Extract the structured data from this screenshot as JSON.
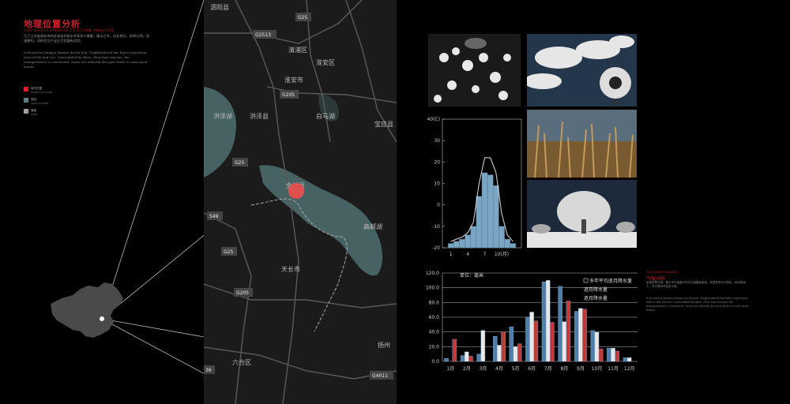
{
  "left_panel": {
    "title": "地理位置分析",
    "subtitle": "THE GEOGRAPHICAL POSITION ANALYSIS",
    "body_cn": "位于江苏省淮安市的金湖县北依水乡获有千美誉，集水之乡，历史悠久，四季分明，交通便利，同样也可产业生活发展有优势。",
    "body_en": "Is located in Jiangsu Huaian Jin Hu-Jian, Neighborhood has had a reputation, land of fish and rice. Surrounded by lakes, clear four seasons, the transportation is convenient. Same our industry also give birth to some good homes.",
    "legend": [
      {
        "label": "城市位置",
        "sub": "PROJECT LOCATION",
        "color": "#e21b2a"
      },
      {
        "label": "湖泊",
        "sub": "LAKE LOCATION",
        "color": "#5c7f80"
      },
      {
        "label": "道路",
        "sub": "ROAD",
        "color": "#a89da0"
      }
    ]
  },
  "map_labels": {
    "sihong": "泗阳县",
    "g25_top": "G25",
    "g2513": "G2513",
    "huaian": "淮安市",
    "qinghe": "清浦区",
    "huaiyin": "淮安区",
    "g205_a": "G205",
    "hongze_lake": "洪泽湖",
    "hongze": "洪泽县",
    "baima": "白马湖",
    "baoying": "宝应县",
    "g25_mid": "G25",
    "jinhu": "金湖县",
    "s49": "S49",
    "gaoyou_lake": "高邮湖",
    "g25_low": "G25",
    "tianchang": "天长市",
    "g205_b": "G205",
    "yangzhou": "扬州",
    "luhe": "六合区",
    "g4011": "G4011",
    "s36": "36"
  },
  "right_annotation": {
    "title_en": "THE CLIMATE ANALYSIS",
    "title": "气候分析",
    "body_cn": "金湖四季分明，春天冷均温度开在升在温暖适宜度，明显夏季长日照足，秋凉爽宜人，冬冷寒有时较多中雨。",
    "body_en": "Is located in Jiangsu Huaian Jin Hu-Jian, Neighborhood has had a reputation, land of fish and rice. Surrounded by lakes, clear four seasons, the transportation is convenient. Same our industry also give birth to some good homes."
  },
  "chart_data": [
    {
      "type": "bar",
      "title": "",
      "ylabel_top": "40(C)",
      "y_ticks": [
        40,
        30,
        20,
        10,
        0,
        -10,
        -20
      ],
      "x_ticks": [
        "1",
        "4",
        "7",
        "10(月)"
      ],
      "ylim": [
        -20,
        40
      ],
      "categories": [
        "1",
        "2",
        "3",
        "4",
        "5",
        "6",
        "7",
        "8",
        "9",
        "10",
        "11",
        "12"
      ],
      "bars_values": [
        -18,
        -17,
        -16,
        -14,
        -10,
        4,
        15,
        14,
        9,
        -10,
        -16,
        -18
      ],
      "curve_values": [
        -17,
        -16,
        -15,
        -13,
        -8,
        10,
        22,
        22,
        15,
        -4,
        -14,
        -17
      ]
    },
    {
      "type": "bar",
      "unit_label": "单位：毫米",
      "y_ticks": [
        "120.0",
        "100.0",
        "80.0",
        "60.0",
        "40.0",
        "20.0",
        "0.0"
      ],
      "ylim": [
        0,
        120
      ],
      "categories": [
        "1月",
        "2月",
        "3月",
        "4月",
        "5月",
        "6月",
        "7月",
        "8月",
        "9月",
        "10月",
        "11月",
        "12月"
      ],
      "legend": [
        "多年平均逐月降水量",
        "逐月降水量",
        "逐月降水量"
      ],
      "series": [
        {
          "name": "多年平均逐月降水量",
          "color": "#4f7fa8",
          "values": [
            4,
            8,
            10,
            34,
            47,
            60,
            108,
            102,
            68,
            42,
            18,
            5
          ]
        },
        {
          "name": "逐月降水量",
          "color": "#e8e8e8",
          "values": [
            0,
            13,
            42,
            22,
            20,
            67,
            110,
            54,
            72,
            40,
            18,
            5
          ]
        },
        {
          "name": "逐月降水量",
          "color": "#c23b3b",
          "values": [
            30,
            7,
            0,
            40,
            24,
            55,
            53,
            82,
            71,
            17,
            14,
            0
          ]
        }
      ]
    }
  ],
  "colors": {
    "accent": "#d0202a",
    "lake": "#5c7f80",
    "marker": "#e05050"
  }
}
